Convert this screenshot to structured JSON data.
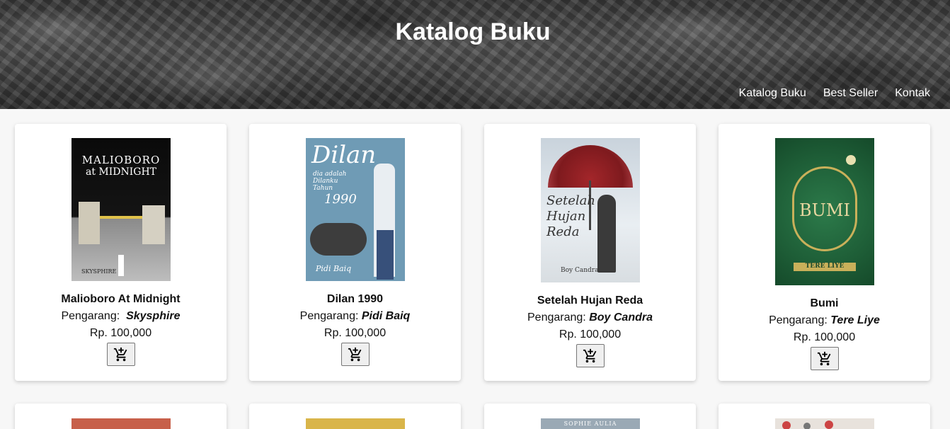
{
  "header": {
    "title": "Katalog Buku",
    "nav": [
      "Katalog Buku",
      "Best Seller",
      "Kontak"
    ]
  },
  "labels": {
    "author_prefix": "Pengarang:"
  },
  "books": [
    {
      "title": "Malioboro At Midnight",
      "author": "Skysphire",
      "price": "Rp. 100,000",
      "cover_text": [
        "MALIOBORO",
        "at MIDNIGHT",
        "SKYSPHIRE"
      ]
    },
    {
      "title": "Dilan 1990",
      "author": "Pidi Baiq",
      "price": "Rp. 100,000",
      "cover_text": [
        "Dilan",
        "dia adalah Dilanku Tahun",
        "1990",
        "Pidi Baiq"
      ]
    },
    {
      "title": "Setelah Hujan Reda",
      "author": "Boy Candra",
      "price": "Rp. 100,000",
      "cover_text": [
        "Setelah Hujan Reda",
        "Boy Candra"
      ]
    },
    {
      "title": "Bumi",
      "author": "Tere Liye",
      "price": "Rp. 100,000",
      "cover_text": [
        "BUMI",
        "TERE LIYE"
      ]
    }
  ],
  "row2_cover_text": [
    "SOPHIE AULIA"
  ],
  "colors": {
    "header_text": "#ffffff",
    "card_bg": "#ffffff",
    "page_bg": "#f7f7f7"
  },
  "icons": {
    "cart": "cart-plus-icon"
  }
}
